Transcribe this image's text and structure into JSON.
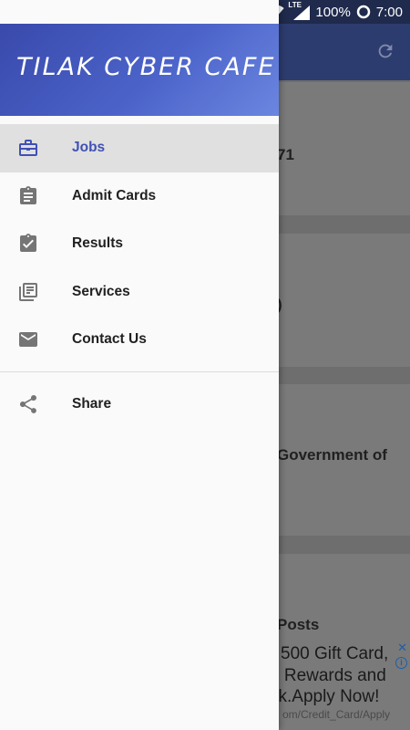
{
  "status_bar": {
    "battery": "100%",
    "time": "7:00",
    "network": "LTE",
    "icons": [
      "alarm-icon",
      "wifi-icon",
      "signal-icon",
      "battery-ring-icon"
    ]
  },
  "background": {
    "card_texts": [
      "71",
      ")",
      "Government of",
      "Posts"
    ],
    "refresh_icon": "refresh-icon"
  },
  "ad": {
    "lines": [
      "500 Gift Card,",
      "n Rewards and",
      "ck.Apply Now!"
    ],
    "url": "om/Credit_Card/Apply",
    "close": "✕",
    "info": "i"
  },
  "drawer": {
    "title": "TILAK CYBER CAFE",
    "items": [
      {
        "label": "Jobs",
        "icon": "briefcase-icon",
        "active": true
      },
      {
        "label": "Admit Cards",
        "icon": "clipboard-icon",
        "active": false
      },
      {
        "label": "Results",
        "icon": "clipboard-check-icon",
        "active": false
      },
      {
        "label": "Services",
        "icon": "library-books-icon",
        "active": false
      },
      {
        "label": "Contact Us",
        "icon": "email-icon",
        "active": false
      }
    ],
    "share": {
      "label": "Share",
      "icon": "share-icon"
    }
  },
  "colors": {
    "accent": "#3f51b5",
    "header_gradient_start": "#3949ab",
    "header_gradient_end": "#6b86e0",
    "icon_gray": "#757575"
  }
}
